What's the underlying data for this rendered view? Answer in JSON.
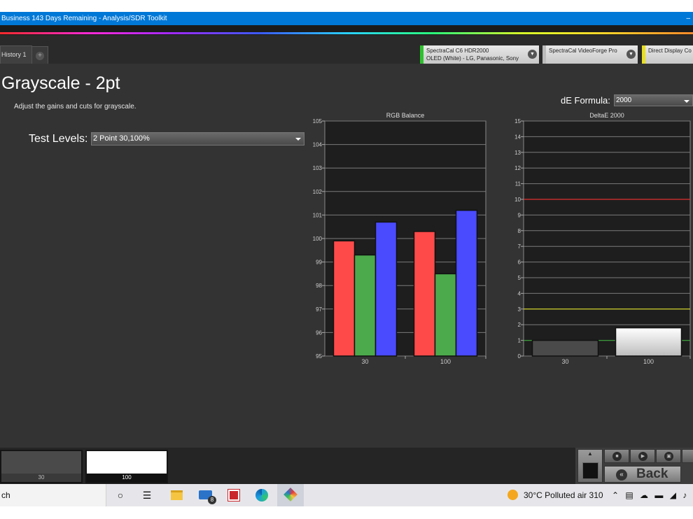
{
  "window": {
    "title": "Business 143 Days Remaining  - Analysis/SDR Toolkit",
    "win_btn": "–"
  },
  "tabs": {
    "doc_tab": "History 1",
    "add_icon": "+"
  },
  "devices": [
    {
      "line1": "SpectraCal C6 HDR2000",
      "line2": "OLED (White) - LG, Panasonic, Sony",
      "accent": "#2ec12e"
    },
    {
      "line1": "SpectraCal VideoForge Pro",
      "line2": "",
      "accent": "#bbbbbb"
    },
    {
      "line1": "Direct Display Co",
      "line2": "",
      "accent": "#e8e020"
    }
  ],
  "page": {
    "title": "Grayscale - 2pt",
    "subtitle": "Adjust the gains and cuts for grayscale.",
    "test_levels_label": "Test Levels:",
    "test_levels_value": "2 Point 30,100%",
    "de_formula_label": "dE Formula:",
    "de_formula_value": "2000"
  },
  "chart_data": [
    {
      "type": "bar",
      "title": "RGB Balance",
      "categories": [
        "30",
        "100"
      ],
      "series": [
        {
          "name": "",
          "color": "#ff4a4a",
          "values": [
            99.9,
            100.3
          ]
        },
        {
          "name": "",
          "color": "#4caa4c",
          "values": [
            99.3,
            98.5
          ]
        },
        {
          "name": "",
          "color": "#4a4aff",
          "values": [
            100.7,
            101.2
          ]
        }
      ],
      "ylim": [
        95,
        105
      ],
      "yticks": [
        "95",
        "96",
        "97",
        "98",
        "99",
        "100",
        "101",
        "102",
        "103",
        "104",
        "105"
      ],
      "grid": true
    },
    {
      "type": "bar",
      "title": "DeltaE 2000",
      "categories": [
        "30",
        "100"
      ],
      "series": [
        {
          "name": "",
          "values": [
            1.0,
            1.8
          ],
          "fills": [
            "#4a4a4a",
            "#ffffff"
          ]
        }
      ],
      "ylim": [
        0,
        15
      ],
      "yticks": [
        "0",
        "1",
        "2",
        "3",
        "4",
        "5",
        "6",
        "7",
        "8",
        "9",
        "10",
        "11",
        "12",
        "13",
        "14",
        "15"
      ],
      "reference_lines": [
        {
          "value": 10,
          "color": "#e03030"
        },
        {
          "value": 3,
          "color": "#d8d820"
        },
        {
          "value": 1,
          "color": "#3a9a3a"
        }
      ],
      "grid": true
    }
  ],
  "swatches": [
    {
      "label": "30",
      "color": "#4a4a4a"
    },
    {
      "label": "100",
      "color": "#ffffff"
    }
  ],
  "controls": {
    "back_label": "Back",
    "back_icon": "«",
    "stop_icon": "■",
    "play_icon": "▶",
    "save_icon": "▣",
    "up_icon": "▲"
  },
  "taskbar": {
    "search_text": "ch",
    "cortana_icon": "○",
    "taskview_icon": "☰",
    "mail_badge": "8",
    "weather": "30°C  Polluted air 310",
    "tray": "⌃ ▤ ☁ ▬ ◢ ♪"
  }
}
